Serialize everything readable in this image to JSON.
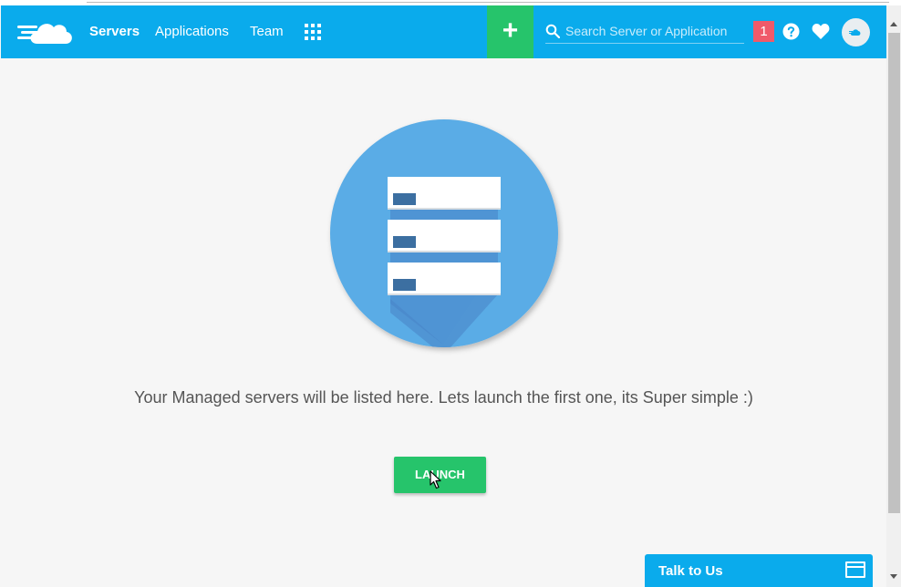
{
  "nav": {
    "links": [
      {
        "label": "Servers",
        "active": true
      },
      {
        "label": "Applications",
        "active": false
      },
      {
        "label": "Team",
        "active": false
      }
    ],
    "apps_icon": "grid-icon",
    "add_label": "+",
    "search_placeholder": "Search Server or Application",
    "notification_count": "1"
  },
  "main": {
    "message": "Your Managed servers will be listed here. Lets launch the first one, its Super simple :)",
    "launch_label": "LAUNCH"
  },
  "chat": {
    "label": "Talk to Us"
  },
  "colors": {
    "brand": "#0aabec",
    "accent_green": "#26c46b",
    "badge_red": "#f05a6a",
    "illustration_blue": "#5aace6"
  }
}
